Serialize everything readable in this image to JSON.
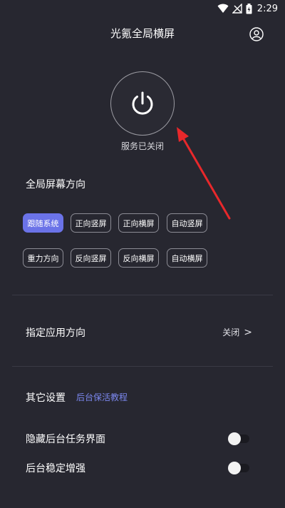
{
  "status_bar": {
    "time": "2:29"
  },
  "header": {
    "title": "光氪全局横屏"
  },
  "power": {
    "status_text": "服务已关闭"
  },
  "orientation": {
    "title": "全局屏幕方向",
    "chips": [
      {
        "label": "跟随系统",
        "active": true
      },
      {
        "label": "正向竖屏",
        "active": false
      },
      {
        "label": "正向横屏",
        "active": false
      },
      {
        "label": "自动竖屏",
        "active": false
      },
      {
        "label": "重力方向",
        "active": false
      },
      {
        "label": "反向竖屏",
        "active": false
      },
      {
        "label": "反向横屏",
        "active": false
      },
      {
        "label": "自动横屏",
        "active": false
      }
    ]
  },
  "app_orientation": {
    "label": "指定应用方向",
    "value": "关闭",
    "chevron": ">"
  },
  "other": {
    "title": "其它设置",
    "link": "后台保活教程",
    "toggles": [
      {
        "label": "隐藏后台任务界面",
        "on": false
      },
      {
        "label": "后台稳定增强",
        "on": false
      }
    ]
  },
  "colors": {
    "background": "#272730",
    "accent": "#6b73e8",
    "link": "#7b87ee",
    "annotation_arrow": "#e8282b"
  },
  "icons": [
    "wifi-icon",
    "signal-icon",
    "battery-icon",
    "profile-icon",
    "power-icon"
  ]
}
